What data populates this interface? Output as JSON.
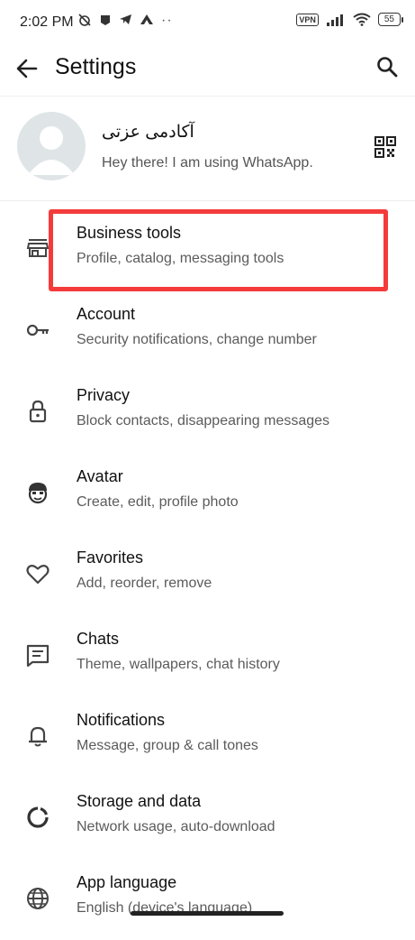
{
  "status_bar": {
    "time": "2:02 PM",
    "vpn": "VPN",
    "battery": "55",
    "dots": "··"
  },
  "header": {
    "title": "Settings"
  },
  "profile": {
    "name": "آکادمی عزتی",
    "status": "Hey there! I am using WhatsApp."
  },
  "menu": [
    {
      "label": "Business tools",
      "sub": "Profile, catalog, messaging tools",
      "icon": "store-icon"
    },
    {
      "label": "Account",
      "sub": "Security notifications, change number",
      "icon": "key-icon"
    },
    {
      "label": "Privacy",
      "sub": "Block contacts, disappearing messages",
      "icon": "lock-icon"
    },
    {
      "label": "Avatar",
      "sub": "Create, edit, profile photo",
      "icon": "avatar-face-icon"
    },
    {
      "label": "Favorites",
      "sub": "Add, reorder, remove",
      "icon": "heart-icon"
    },
    {
      "label": "Chats",
      "sub": "Theme, wallpapers, chat history",
      "icon": "chat-icon"
    },
    {
      "label": "Notifications",
      "sub": "Message, group & call tones",
      "icon": "bell-icon"
    },
    {
      "label": "Storage and data",
      "sub": "Network usage, auto-download",
      "icon": "storage-icon"
    },
    {
      "label": "App language",
      "sub": "English (device's language)",
      "icon": "globe-icon"
    }
  ],
  "colors": {
    "highlight": "#f43b3b",
    "avatar_bg": "#dfe5e7"
  }
}
